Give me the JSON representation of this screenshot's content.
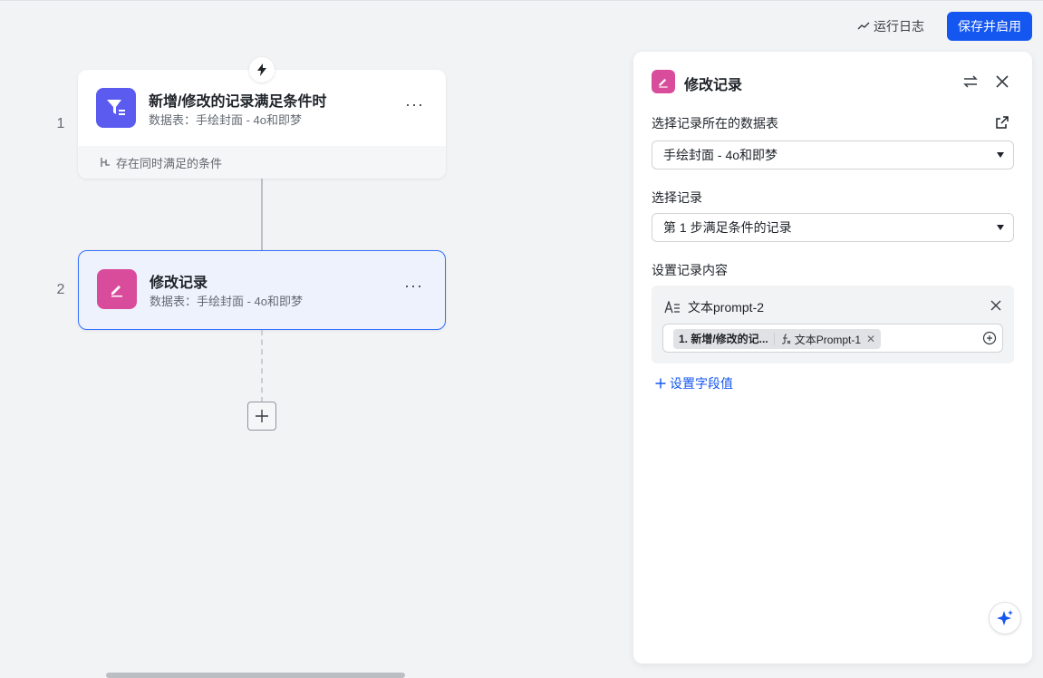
{
  "header": {
    "run_log": "运行日志",
    "save_enable": "保存并启用"
  },
  "workflow": {
    "steps": [
      {
        "number": "1",
        "title": "新增/修改的记录满足条件时",
        "subtitle": "数据表：手绘封面 - 4o和即梦",
        "footer": "存在同时满足的条件",
        "more": "···"
      },
      {
        "number": "2",
        "title": "修改记录",
        "subtitle": "数据表：手绘封面 - 4o和即梦",
        "more": "···"
      }
    ]
  },
  "panel": {
    "title": "修改记录",
    "table_label": "选择记录所在的数据表",
    "table_value": "手绘封面 - 4o和即梦",
    "record_label": "选择记录",
    "record_value": "第 1 步满足条件的记录",
    "content_label": "设置记录内容",
    "field": {
      "name": "文本prompt-2",
      "chip_step": "1. 新增/修改的记...",
      "chip_field": "文本Prompt-1"
    },
    "set_field_value": "设置字段值"
  },
  "colors": {
    "accent": "#1456f0",
    "trigger_icon": "#5b5bf0",
    "action_icon": "#d94c9b",
    "selected_border": "#3370ff"
  }
}
